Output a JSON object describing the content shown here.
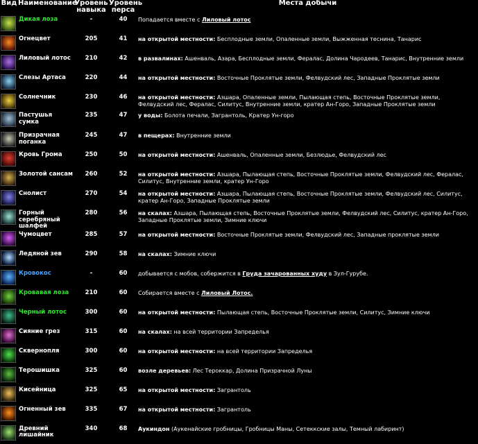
{
  "headers": {
    "icon": "Вид",
    "name": "Наименование",
    "skill": "Уровень навыка",
    "level": "Уровень перса",
    "locations": "Места добычи"
  },
  "rows": [
    {
      "name": "Дикая лоза",
      "color": "#2ee82e",
      "skill": "-",
      "level": "40",
      "prefix": "",
      "text": "Попадается вместе с ",
      "link": "Лиловый лотос",
      "suffix": "",
      "icon": "wild-vine-icon",
      "icon_colors": [
        "#3a5a14",
        "#c9e04a"
      ]
    },
    {
      "name": "Огнецвет",
      "color": "#ffffff",
      "skill": "205",
      "level": "41",
      "prefix": "на открытой местности:",
      "text": " Бесплодные земли, Опаленные земли, Выжженная теснина, Танарис",
      "link": "",
      "suffix": "",
      "icon": "firebloom-icon",
      "icon_colors": [
        "#5a1808",
        "#ff8a20"
      ]
    },
    {
      "name": "Лиловый лотос",
      "color": "#ffffff",
      "skill": "210",
      "level": "42",
      "prefix": "в развалинах:",
      "text": " Ашенваль, Азара, Бесплодные земли, Фералас, Долина Чародеев, Танарис, Внутренние земли",
      "link": "",
      "suffix": "",
      "icon": "purple-lotus-icon",
      "icon_colors": [
        "#2a1250",
        "#b070e8"
      ]
    },
    {
      "name": "Слезы Артаса",
      "color": "#ffffff",
      "skill": "220",
      "level": "44",
      "prefix": "на открытой местности:",
      "text": " Восточные Проклятые земли, Фелвудский лес, Западные Проклятые земли",
      "link": "",
      "suffix": "",
      "icon": "arthas-tears-icon",
      "icon_colors": [
        "#18324a",
        "#8ad0f0"
      ]
    },
    {
      "name": "Солнечник",
      "color": "#ffffff",
      "skill": "230",
      "level": "46",
      "prefix": "на открытой местности:",
      "text": " Азшара, Опаленные земли, Пылающая степь, Восточные Проклятые земли, Фелвудский лес, Фералас, Силитус, Внутренние земли, кратер Ан-Горо, Западные Проклятые земли",
      "link": "",
      "suffix": "",
      "icon": "sungrass-icon",
      "icon_colors": [
        "#4a3a08",
        "#f0d040"
      ]
    },
    {
      "name": "Пастушья сумка",
      "color": "#ffffff",
      "skill": "235",
      "level": "47",
      "prefix": "у воды:",
      "text": " Болота печали, Загрантоль, Кратер Ун-горо",
      "link": "",
      "suffix": "",
      "icon": "blindweed-icon",
      "icon_colors": [
        "#2a3a4a",
        "#a0c0d8"
      ]
    },
    {
      "name": "Призрачная поганка",
      "color": "#ffffff",
      "skill": "245",
      "level": "47",
      "prefix": "в пещерах:",
      "text": " Внутренние земли",
      "link": "",
      "suffix": "",
      "icon": "ghost-mushroom-icon",
      "icon_colors": [
        "#2a2a2a",
        "#c8c8b0"
      ]
    },
    {
      "name": "Кровь Грома",
      "color": "#ffffff",
      "skill": "250",
      "level": "50",
      "prefix": "на открытой местности:",
      "text": " Ашенваль, Опаленные земли, Безлюдье, Фелвудский лес",
      "link": "",
      "suffix": "",
      "icon": "gromsblood-icon",
      "icon_colors": [
        "#4a0a0a",
        "#e04030"
      ]
    },
    {
      "name": "Золотой сансам",
      "color": "#ffffff",
      "skill": "260",
      "level": "52",
      "prefix": "на открытой местности:",
      "text": " Азшара, Пылающая степь, Восточные Проклятые земли, Фелвудский лес, Фералас, Силитус, Внутренние земли, кратер Ун-Горо",
      "link": "",
      "suffix": "",
      "icon": "golden-sansam-icon",
      "icon_colors": [
        "#3a2a10",
        "#d8b050"
      ]
    },
    {
      "name": "Снолист",
      "color": "#ffffff",
      "skill": "270",
      "level": "54",
      "prefix": "на открытой местности:",
      "text": " Азшара, Пылающая степь, Восточные Проклятые земли, Фелвудский лес, Силитус, кратер Ан-Горо, Западные Проклятые земли",
      "link": "",
      "suffix": "",
      "icon": "dreamfoil-icon",
      "icon_colors": [
        "#1a1a4a",
        "#8080e8"
      ]
    },
    {
      "name": "Горный серебряный шалфей",
      "color": "#ffffff",
      "skill": "280",
      "level": "56",
      "prefix": "на скалах:",
      "text": " Азшара, Пылающая степь, Восточные Проклятые земли, Фелвудский лес, Силитус, кратер Ан-Горо, Западные Проклятые земли, Зимние ключи",
      "link": "",
      "suffix": "",
      "icon": "mountain-silversage-icon",
      "icon_colors": [
        "#1a3a3a",
        "#a0e0d0"
      ]
    },
    {
      "name": "Чумоцвет",
      "color": "#ffffff",
      "skill": "285",
      "level": "57",
      "prefix": "на открытой местности:",
      "text": " Восточные Проклятые земли, Фелвудский лес, Западные проклятые земли",
      "link": "",
      "suffix": "",
      "icon": "plaguebloom-icon",
      "icon_colors": [
        "#3a0a4a",
        "#d060f0"
      ]
    },
    {
      "name": "Ледяной зев",
      "color": "#ffffff",
      "skill": "290",
      "level": "58",
      "prefix": "на скалах:",
      "text": " Зимние ключи",
      "link": "",
      "suffix": "",
      "icon": "icecap-icon",
      "icon_colors": [
        "#0a1a3a",
        "#b0d8ff"
      ]
    },
    {
      "name": "Кровокос",
      "color": "#4aa0ff",
      "skill": "-",
      "level": "60",
      "prefix": "",
      "text": "добывается с мобов, собержится в ",
      "link": "Груда зачарованных худу",
      "suffix": " в Зул-Гурубе.",
      "icon": "bloodvine-icon",
      "icon_colors": [
        "#0a2a5a",
        "#60b0ff"
      ]
    },
    {
      "name": "Кровавая лоза",
      "color": "#2ee82e",
      "skill": "210",
      "level": "60",
      "prefix": "",
      "text": "Собирается вместе с ",
      "link": "Лиловый Лотос.",
      "suffix": "",
      "icon": "blood-vine-icon",
      "icon_colors": [
        "#1a3a0a",
        "#70d040"
      ]
    },
    {
      "name": "Черный лотос",
      "color": "#2ee82e",
      "skill": "300",
      "level": "60",
      "prefix": "на открытой местности:",
      "text": " Пылающая степь, Восточные Проклятые земли, Силитус, Зимние ключи",
      "link": "",
      "suffix": "",
      "icon": "black-lotus-icon",
      "icon_colors": [
        "#0a2a1a",
        "#40c090"
      ]
    },
    {
      "name": "Сияние грез",
      "color": "#ffffff",
      "skill": "315",
      "level": "60",
      "prefix": "на скалах:",
      "text": " на всей территории Запределья",
      "link": "",
      "suffix": "",
      "icon": "dreaming-glory-icon",
      "icon_colors": [
        "#3a0a3a",
        "#e070d0"
      ]
    },
    {
      "name": "Сквернопля",
      "color": "#ffffff",
      "skill": "300",
      "level": "60",
      "prefix": "на открытой местности:",
      "text": " на всей территории Запределья",
      "link": "",
      "suffix": "",
      "icon": "felweed-icon",
      "icon_colors": [
        "#0a3a0a",
        "#50e050"
      ]
    },
    {
      "name": "Терошишка",
      "color": "#ffffff",
      "skill": "325",
      "level": "60",
      "prefix": "возле деревьев:",
      "text": " Лес Тероккар, Долина Призрачной Луны",
      "link": "",
      "suffix": "",
      "icon": "terocone-icon",
      "icon_colors": [
        "#0a2a0a",
        "#60c040"
      ]
    },
    {
      "name": "Кисейница",
      "color": "#ffffff",
      "skill": "325",
      "level": "65",
      "prefix": "на открытой местности:",
      "text": " Загрантоль",
      "link": "",
      "suffix": "",
      "icon": "ragveil-icon",
      "icon_colors": [
        "#3a2a0a",
        "#f0c060"
      ]
    },
    {
      "name": "Огненный зев",
      "color": "#ffffff",
      "skill": "335",
      "level": "67",
      "prefix": "на открытой местности:",
      "text": " Загрантоль",
      "link": "",
      "suffix": "",
      "icon": "flame-cap-icon",
      "icon_colors": [
        "#4a1a00",
        "#ff9020"
      ]
    },
    {
      "name": "Древний лишайник",
      "color": "#ffffff",
      "skill": "340",
      "level": "68",
      "prefix": "Аукиндон",
      "text": " (Аукенайские гробницы, Гробницы Маны, Сетеккские залы, Темный лабиринт)",
      "link": "",
      "suffix": "",
      "icon": "ancient-lichen-icon",
      "icon_colors": [
        "#1a3a1a",
        "#a0e070"
      ]
    }
  ]
}
